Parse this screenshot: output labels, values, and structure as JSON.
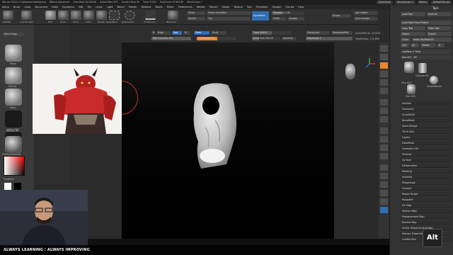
{
  "titlebar": {
    "items": [
      "ZBrush 2023.1.2 [Abraham.Rodriguez]",
      "ZBrush Document",
      "Free Mem 24.050GB",
      "Active Mem 971",
      "Scratch Disk 45",
      "Timer 0.001",
      "PolyCount 33.903 KP",
      "MeshCount 1"
    ],
    "quicksave": "QuickSave",
    "see_through": "See-through 0",
    "menus": "Menus",
    "script": "DefaultZScript"
  },
  "menubar": [
    "Alpha",
    "Brush",
    "Color",
    "Document",
    "Draw",
    "Dynamics",
    "Edit",
    "File",
    "Layer",
    "Light",
    "Macro",
    "Marker",
    "Material",
    "Movie",
    "Picker",
    "Preferences",
    "Render",
    "Stencil",
    "Stroke",
    "Texture",
    "Tool",
    "Transform",
    "Zplugin",
    "Zscript",
    "Help"
  ],
  "toolbar": {
    "tools": [
      "LightBox",
      "Live Boolean",
      "Edit",
      "Draw",
      "Move",
      "Scale",
      "Rotate",
      "SelectRect",
      "SelectLasso",
      "KnifeCurve",
      "ZModeler"
    ],
    "mirror": "Mirror",
    "mirror_weld": "Mirror And Weld",
    "double": "Double",
    "flip": "Flip",
    "dynamesh": "DynaMesh",
    "resolution": "Resolution 128",
    "polish": "Polish",
    "groups": "Groups",
    "divide": "Divide",
    "del_hidden": "Del Hidden",
    "auto_groups": "Auto Groups",
    "mrgb": "Mrgb",
    "rgb": "Rgb",
    "m": "M",
    "zadd": "Zadd",
    "zsub": "Zsub",
    "rgb_intensity": "Rgb Intensity 100",
    "z_intensity": "Z Intensity 51",
    "focal_shift": "Focal Shift 0",
    "draw_size": "Draw Size 250.25",
    "dynamic": "Dynamic",
    "replay_last": "ReplayLast",
    "replay_last_rel": "ReplayLastRel",
    "adjust_last": "AdjustLast 1",
    "active_points": "ActivePoints: 32,826",
    "total_points": "TotalPoints: 174,859"
  },
  "leftshelf": {
    "home_page": "Home Page",
    "brushes": [
      "Move",
      "Stdnrd",
      "Dam_",
      "ClayBuildup"
    ],
    "alpha_off": "Alpha Off",
    "texture_off": "Texture Off",
    "material": "StartupMaterial",
    "gradient": "Gradient",
    "switch_color": "SwitchColor"
  },
  "navcol": [
    "BPR",
    "SPix 3",
    "Scroll",
    "Zoom",
    "Actual",
    "AAHalf",
    "Persp",
    "Floor",
    "Local",
    "Frame",
    "Move",
    "Zoom3D",
    "Rotate",
    "Line Fill",
    "PolyF",
    "Transp",
    "Ghost",
    "Solo",
    "Xpose"
  ],
  "tray": {
    "title": "Tool",
    "buttons": [
      [
        "Load Tool",
        "Save As"
      ],
      [
        "Load Tools From Project",
        ""
      ],
      [
        "Copy Tool",
        "Paste Tool"
      ],
      [
        "Import",
        "Export"
      ],
      [
        "Clone",
        "Make PolyMesh3D"
      ],
      [
        "GoZ",
        "All",
        "Visible",
        "R"
      ]
    ],
    "lightbox_tools": "Lightbox > Tools",
    "current_tool": "Dec-001 . 48",
    "tool_thumbs": [
      "Dec-001",
      "Cylinder3D",
      "SimpleBrush",
      "Dec-001"
    ],
    "sections": [
      "Subtool",
      "Geometry",
      "ArrayMesh",
      "NanoMesh",
      "Slime Bridge",
      "Thick Skin",
      "Layers",
      "FiberMesh",
      "Geometry HD",
      "Preview",
      "Surface",
      "Deformation",
      "Masking",
      "Visibility",
      "Polygroups",
      "Contact",
      "Morph Target",
      "Polypaint",
      "UV Map",
      "Texture Map",
      "Displacement Map",
      "Normal Map",
      "Vector Displacement Map",
      "Display Properties",
      "Unified Skin"
    ]
  },
  "footer": "ALWAYS LEARNING  /  ALWAYS IMPROVING",
  "alt_key": "Alt",
  "colors": {
    "accent": "#e8872b",
    "active_blue": "#2f6fb3",
    "background": "#2b2b2b"
  }
}
